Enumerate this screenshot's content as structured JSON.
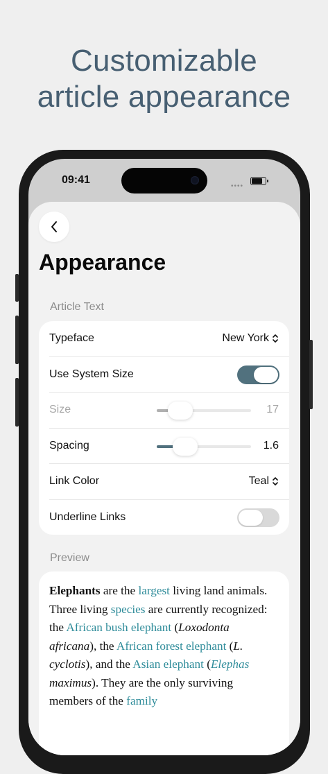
{
  "headline": {
    "line1": "Customizable",
    "line2": "article appearance"
  },
  "status_bar": {
    "time": "09:41"
  },
  "nav": {
    "back_icon": "chevron-left-icon"
  },
  "page": {
    "title": "Appearance"
  },
  "article_text": {
    "section_label": "Article Text",
    "typeface": {
      "label": "Typeface",
      "value": "New York"
    },
    "use_system_size": {
      "label": "Use System Size",
      "enabled": true
    },
    "size": {
      "label": "Size",
      "value": "17",
      "level": 0.25,
      "disabled": true
    },
    "spacing": {
      "label": "Spacing",
      "value": "1.6",
      "level": 0.3
    },
    "link_color": {
      "label": "Link Color",
      "value": "Teal"
    },
    "underline_links": {
      "label": "Underline Links",
      "enabled": false
    }
  },
  "preview": {
    "section_label": "Preview",
    "parts": [
      {
        "t": "Elephants",
        "b": true
      },
      {
        "t": " are the "
      },
      {
        "t": "largest",
        "link": true
      },
      {
        "t": " living land animals. Three living "
      },
      {
        "t": "species",
        "link": true
      },
      {
        "t": " are currently recognized: the "
      },
      {
        "t": "African bush elephant",
        "link": true
      },
      {
        "t": " ("
      },
      {
        "t": "Loxodonta africana",
        "i": true
      },
      {
        "t": "), the "
      },
      {
        "t": "African forest elephant",
        "link": true
      },
      {
        "t": " ("
      },
      {
        "t": "L. cyclotis",
        "i": true
      },
      {
        "t": "), and the "
      },
      {
        "t": "Asian elephant",
        "link": true
      },
      {
        "t": " ("
      },
      {
        "t": "Elephas",
        "link": true,
        "i": true
      },
      {
        "t": " maximus",
        "i": true
      },
      {
        "t": "). They are the only surviving members of the "
      },
      {
        "t": "family",
        "link": true
      }
    ]
  },
  "colors": {
    "accent": "#51717e",
    "link": "#2f8c9a",
    "headline": "#475f72"
  }
}
